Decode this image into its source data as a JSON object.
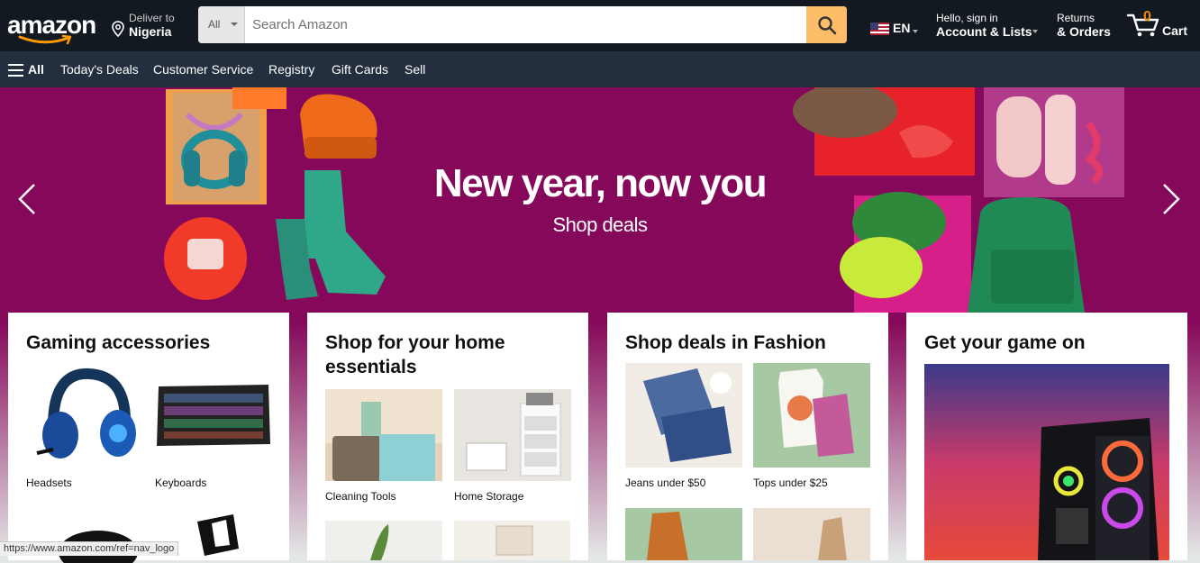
{
  "header": {
    "logo_text": "amazon",
    "deliver_to_label": "Deliver to",
    "deliver_to_location": "Nigeria",
    "search": {
      "category": "All",
      "placeholder": "Search Amazon",
      "value": ""
    },
    "language": "EN",
    "account_greeting": "Hello, sign in",
    "account_label": "Account & Lists",
    "returns_label": "Returns",
    "orders_label": "& Orders",
    "cart_count": "0",
    "cart_label": "Cart"
  },
  "subnav": {
    "all_label": "All",
    "items": [
      "Today's Deals",
      "Customer Service",
      "Registry",
      "Gift Cards",
      "Sell"
    ]
  },
  "hero": {
    "title": "New year, now you",
    "subtitle": "Shop deals"
  },
  "cards": [
    {
      "title": "Gaming accessories",
      "tiles": [
        "Headsets",
        "Keyboards"
      ]
    },
    {
      "title": "Shop for your home essentials",
      "tiles": [
        "Cleaning Tools",
        "Home Storage"
      ]
    },
    {
      "title": "Shop deals in Fashion",
      "tiles": [
        "Jeans under $50",
        "Tops under $25"
      ]
    },
    {
      "title": "Get your game on"
    }
  ],
  "status_bar": "https://www.amazon.com/ref=nav_logo",
  "colors": {
    "nav_bg": "#131921",
    "subnav_bg": "#232f3e",
    "search_button": "#febd69",
    "cart_count": "#f08804",
    "hero_bg": "#85085a"
  }
}
